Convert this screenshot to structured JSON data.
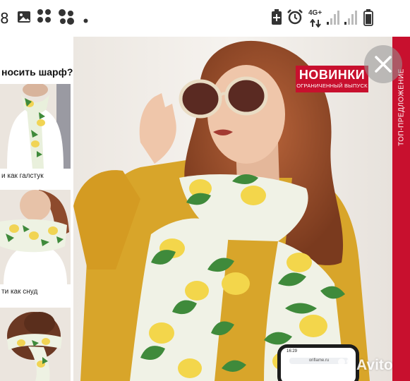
{
  "status_bar": {
    "time_fragment": "8",
    "network": "4G+",
    "icons": [
      "gallery-icon",
      "app-cluster-icon",
      "app-cluster-icon",
      "dot-icon",
      "battery-saver-icon",
      "alarm-icon",
      "network-arrows-icon",
      "signal-icon",
      "signal-icon",
      "battery-icon"
    ]
  },
  "catalog": {
    "left_title": "носить шарф?",
    "thumbs": [
      {
        "caption": "и как галстук"
      },
      {
        "caption": "ти как снуд"
      },
      {
        "caption": ""
      }
    ],
    "badge": {
      "title": "НОВИНКИ",
      "subtitle": "ОГРАНИЧЕННЫЙ ВЫПУСК"
    },
    "side_strip": "ТОП-ПРЕДЛОЖЕНИЕ",
    "phone": {
      "time": "16:29",
      "url": "oriflame.ru"
    },
    "colors": {
      "brand_red": "#c8102e",
      "mustard": "#d8a52a",
      "lemon": "#f3d64b",
      "leaf": "#3f8a3b"
    }
  },
  "overlay": {
    "close_icon": "close-icon",
    "watermark": "Avito"
  }
}
